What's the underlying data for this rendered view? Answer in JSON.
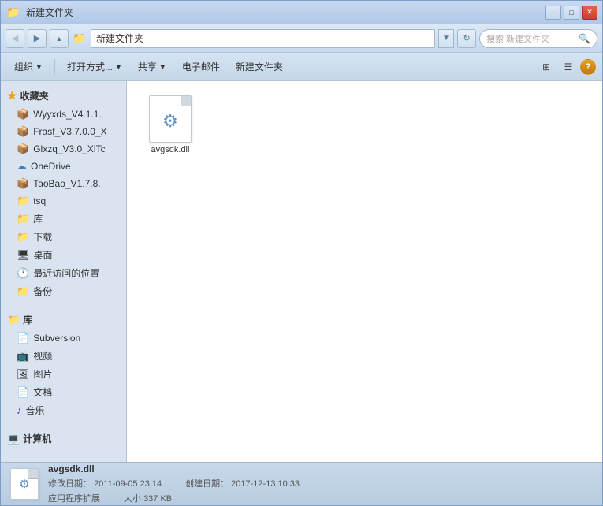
{
  "window": {
    "title": "新建文件夹",
    "title_buttons": {
      "minimize": "─",
      "maximize": "□",
      "close": "✕"
    }
  },
  "address_bar": {
    "path": "新建文件夹",
    "search_placeholder": "搜索 新建文件夹"
  },
  "toolbar": {
    "organize_label": "组织",
    "open_with_label": "打开方式...",
    "share_label": "共享",
    "email_label": "电子邮件",
    "new_folder_label": "新建文件夹"
  },
  "sidebar": {
    "favorites_label": "收藏夹",
    "items_favorites": [
      {
        "name": "Wyyxds_V4.1.1.",
        "icon": "📦"
      },
      {
        "name": "Frasf_V3.7.0.0_X",
        "icon": "📦"
      },
      {
        "name": "Glxzq_V3.0_XiTc",
        "icon": "📦"
      },
      {
        "name": "OneDrive",
        "icon": "☁"
      },
      {
        "name": "TaoBao_V1.7.8.",
        "icon": "📦"
      },
      {
        "name": "tsq",
        "icon": "📁"
      },
      {
        "name": "库",
        "icon": "📁"
      },
      {
        "name": "下载",
        "icon": "📁"
      },
      {
        "name": "桌面",
        "icon": "🖥"
      },
      {
        "name": "最近访问的位置",
        "icon": "🕐"
      },
      {
        "name": "备份",
        "icon": "📁"
      }
    ],
    "library_label": "库",
    "items_library": [
      {
        "name": "Subversion",
        "icon": "📄"
      },
      {
        "name": "视频",
        "icon": "📺"
      },
      {
        "name": "图片",
        "icon": "🖼"
      },
      {
        "name": "文档",
        "icon": "📄"
      },
      {
        "name": "音乐",
        "icon": "♪"
      }
    ],
    "computer_label": "计算机"
  },
  "file_area": {
    "files": [
      {
        "name": "avgsdk.dll",
        "type": "dll"
      }
    ]
  },
  "status_bar": {
    "file_name": "avgsdk.dll",
    "file_type": "应用程序扩展",
    "modified_label": "修改日期：",
    "modified_date": "2011-09-05 23:14",
    "created_label": "创建日期：",
    "created_date": "2017-12-13 10:33",
    "size_label": "大小",
    "size_value": "337 KB"
  }
}
